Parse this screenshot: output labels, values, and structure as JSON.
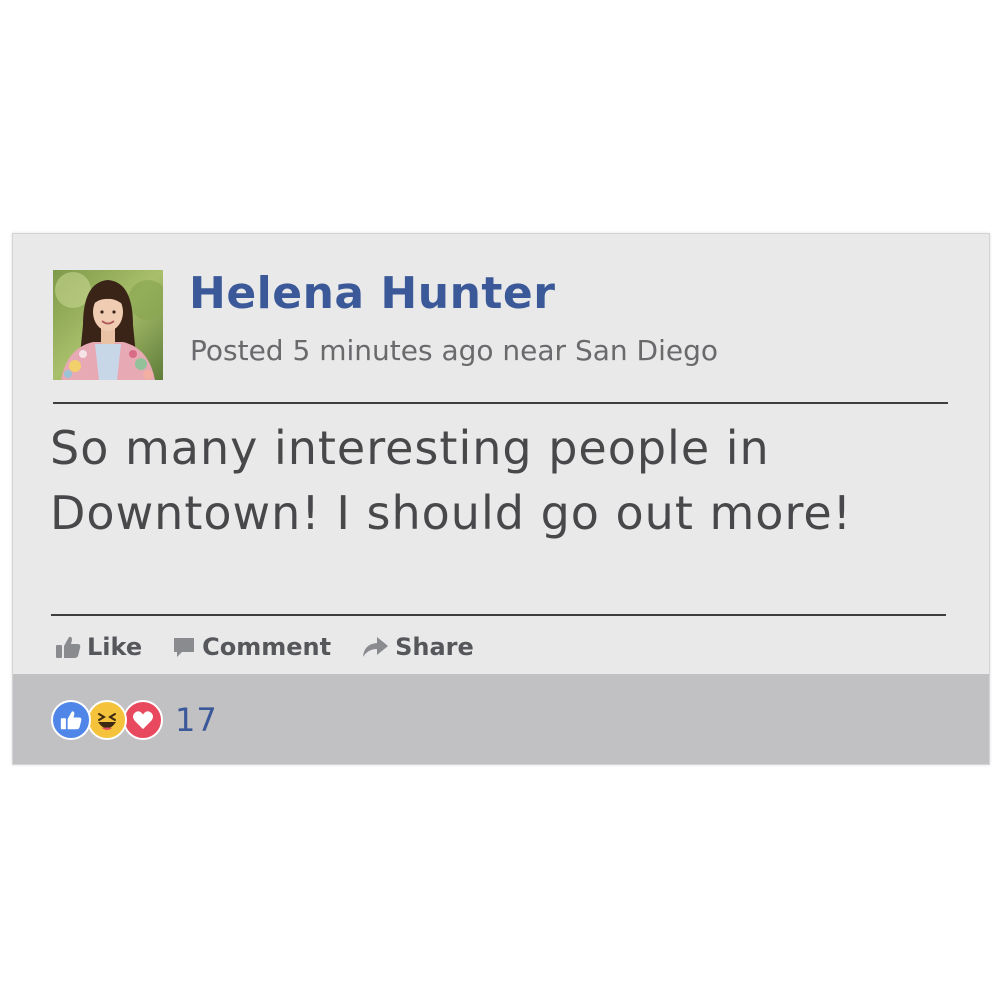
{
  "post": {
    "author": "Helena Hunter",
    "meta": "Posted 5 minutes ago near San Diego",
    "message": "So many interesting people in Downtown! I should go out more!",
    "avatar_alt": "Helena Hunter profile photo"
  },
  "actions": {
    "like_label": "Like",
    "comment_label": "Comment",
    "share_label": "Share"
  },
  "reactions": {
    "types": [
      "like",
      "haha",
      "love"
    ],
    "count": "17"
  },
  "colors": {
    "author_blue": "#3b5998",
    "like_blue": "#4f86e8",
    "haha_yellow": "#f5c33b",
    "love_red": "#e9495f",
    "card_bg": "#e9e9ea",
    "footer_bg": "#c1c1c3"
  },
  "icons": {
    "like": "thumbs-up-icon",
    "comment": "speech-bubble-icon",
    "share": "share-arrow-icon"
  }
}
